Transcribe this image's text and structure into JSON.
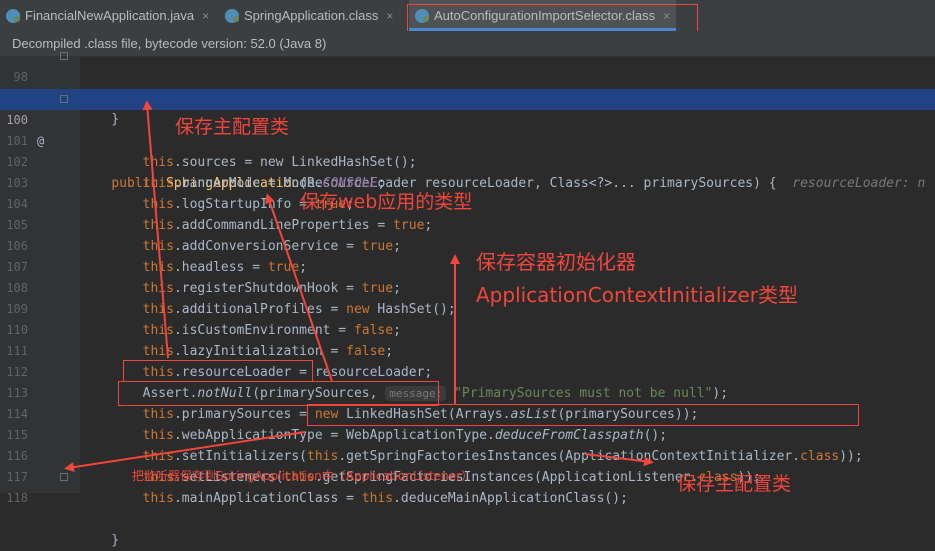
{
  "tabs": [
    {
      "label": "FinancialNewApplication.java",
      "close": "×"
    },
    {
      "label": "SpringApplication.class",
      "close": "×"
    },
    {
      "label": "AutoConfigurationImportSelector.class",
      "close": "×"
    }
  ],
  "info": "Decompiled .class file, bytecode version: 52.0 (Java 8)",
  "lines": {
    "l98": {
      "num": "98",
      "text": "    }"
    },
    "l99": {
      "num": "99"
    },
    "l100": {
      "num": "100",
      "marker": "@",
      "kw": "public ",
      "method": "SpringApplication",
      "rest": "(ResourceLoader resourceLoader, Class<?>... primarySources) {",
      "hint": "resourceLoader: n"
    },
    "l101": {
      "num": "101",
      "this": "this",
      "rest": ".sources = new LinkedHashSet();"
    },
    "l102": {
      "num": "102",
      "this": "this",
      "rest": ".bannerMode = Mode.",
      "const": "CONSOLE",
      "end": ";"
    },
    "l103": {
      "num": "103",
      "this": "this",
      "rest": ".logStartupInfo = ",
      "kw": "true",
      "end": ";"
    },
    "l104": {
      "num": "104",
      "this": "this",
      "rest": ".addCommandLineProperties = ",
      "kw": "true",
      "end": ";"
    },
    "l105": {
      "num": "105",
      "this": "this",
      "rest": ".addConversionService = ",
      "kw": "true",
      "end": ";"
    },
    "l106": {
      "num": "106",
      "this": "this",
      "rest": ".headless = ",
      "kw": "true",
      "end": ";"
    },
    "l107": {
      "num": "107",
      "this": "this",
      "rest": ".registerShutdownHook = ",
      "kw": "true",
      "end": ";"
    },
    "l108": {
      "num": "108",
      "this": "this",
      "rest": ".additionalProfiles = ",
      "kw": "new",
      "end": " HashSet();"
    },
    "l109": {
      "num": "109",
      "this": "this",
      "rest": ".isCustomEnvironment = ",
      "kw": "false",
      "end": ";"
    },
    "l110": {
      "num": "110",
      "this": "this",
      "rest": ".lazyInitialization = ",
      "kw": "false",
      "end": ";"
    },
    "l111": {
      "num": "111",
      "this": "this",
      "rest": ".resourceLoader = resourceLoader;"
    },
    "l112": {
      "num": "112",
      "pre": "Assert.",
      "method": "notNull",
      "rest": "(primarySources, ",
      "hint": "message:",
      "str": "\"PrimarySources must not be null\"",
      "end": ");"
    },
    "l113": {
      "num": "113",
      "this": "this",
      "rest": ".primarySources = ",
      "kw": "new",
      "end": " LinkedHashSet(Arrays.",
      "method": "asList",
      "tail": "(primarySources));"
    },
    "l114": {
      "num": "114",
      "this": "this",
      "rest": ".webApplicationType = WebApplicationType.",
      "method": "deduceFromClasspath",
      "end": "();"
    },
    "l115": {
      "num": "115",
      "this": "this",
      "rest": ".setInitializers(",
      "this2": "this",
      "mid": ".getSpringFactoriesInstances(ApplicationContextInitializer.",
      "kw": "class",
      "end": "));"
    },
    "l116": {
      "num": "116",
      "this": "this",
      "rest": ".setListeners(",
      "this2": "this",
      "mid": ".getSpringFactoriesInstances(ApplicationListener.",
      "kw": "class",
      "end": "));"
    },
    "l117": {
      "num": "117",
      "this": "this",
      "rest": ".mainApplicationClass = ",
      "this2": "this",
      "end": ".deduceMainApplicationClass();"
    },
    "l118": {
      "num": "118",
      "text": "    }"
    }
  },
  "annotations": {
    "a1": "保存主配置类",
    "a2": "保存web应用的类型",
    "a3_line1": "保存容器初始化器",
    "a3_line2": "ApplicationContextInitializer类型",
    "a4": "把监听器保存到SpringApplication中（ApplicationListener）",
    "a5": "保存主配置类"
  },
  "colors": {
    "annotation": "#f0463c",
    "keyword": "#cc7832",
    "method": "#ffc66d",
    "string": "#6a8759",
    "field": "#9876aa",
    "highlight": "#214283"
  }
}
